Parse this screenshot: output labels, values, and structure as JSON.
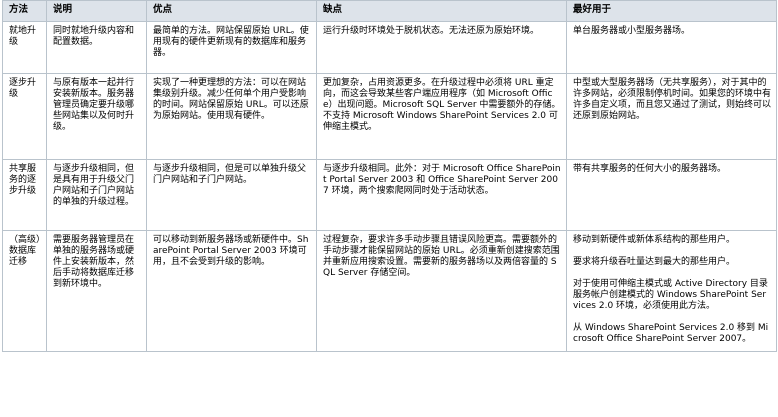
{
  "headers": [
    "方法",
    "说明",
    "优点",
    "缺点",
    "最好用于"
  ],
  "rows": [
    {
      "method": "就地升级",
      "description": "同时就地升级内容和配置数据。",
      "pros": "最简单的方法。网站保留原始 URL。使用现有的硬件更新现有的数据库和服务器。",
      "cons": "运行升级时环境处于脱机状态。无法还原为原始环境。",
      "best_for": [
        "单台服务器或小型服务器场。"
      ]
    },
    {
      "method": "逐步升级",
      "description": "与原有版本一起并行安装新版本。服务器管理员确定要升级哪些网站集以及何时升级。",
      "pros": "实现了一种更理想的方法：可以在网站集级别升级。减少任何单个用户受影响的时间。网站保留原始 URL。可以还原为原始网站。使用现有硬件。",
      "cons": "更加复杂，占用资源更多。在升级过程中必须将 URL 重定向，而这会导致某些客户端应用程序（如 Microsoft Office）出现问题。Microsoft SQL Server 中需要额外的存储。不支持 Microsoft Windows SharePoint Services 2.0 可伸缩主模式。",
      "best_for": [
        "中型或大型服务器场（无共享服务），对于其中的许多网站，必须限制停机时间。如果您的环境中有许多自定义项，而且您又通过了测试，则始终可以还原到原始网站。"
      ]
    },
    {
      "method": "共享服务的逐步升级",
      "description": "与逐步升级相同，但是具有用于升级父门户网站和子门户网站的单独的升级过程。",
      "pros": "与逐步升级相同，但是可以单独升级父门户网站和子门户网站。",
      "cons": "与逐步升级相同。此外：对于 Microsoft Office SharePoint Portal Server 2003 和 Office SharePoint Server 2007 环境，两个搜索爬网同时处于活动状态。",
      "best_for": [
        "带有共享服务的任何大小的服务器场。"
      ]
    },
    {
      "method": "（高级）数据库迁移",
      "description": "需要服务器管理员在单独的服务器场或硬件上安装新版本，然后手动将数据库迁移到新环境中。",
      "pros": "可以移动到新服务器场或新硬件中。SharePoint Portal Server 2003 环境可用，且不会受到升级的影响。",
      "cons": "过程复杂，要求许多手动步骤且错误风险更高。需要额外的手动步骤才能保留网站的原始 URL。必须重新创建搜索范围并重新应用搜索设置。需要新的服务器场以及两倍容量的 SQL Server 存储空间。",
      "best_for": [
        "移动到新硬件或新体系结构的那些用户。",
        "要求将升级吞吐量达到最大的那些用户。",
        "对于使用可伸缩主模式或 Active Directory 目录服务帐户创建模式的 Windows SharePoint Services 2.0 环境，必须使用此方法。",
        "从 Windows SharePoint Services 2.0 移到 Microsoft Office SharePoint Server 2007。"
      ]
    }
  ]
}
